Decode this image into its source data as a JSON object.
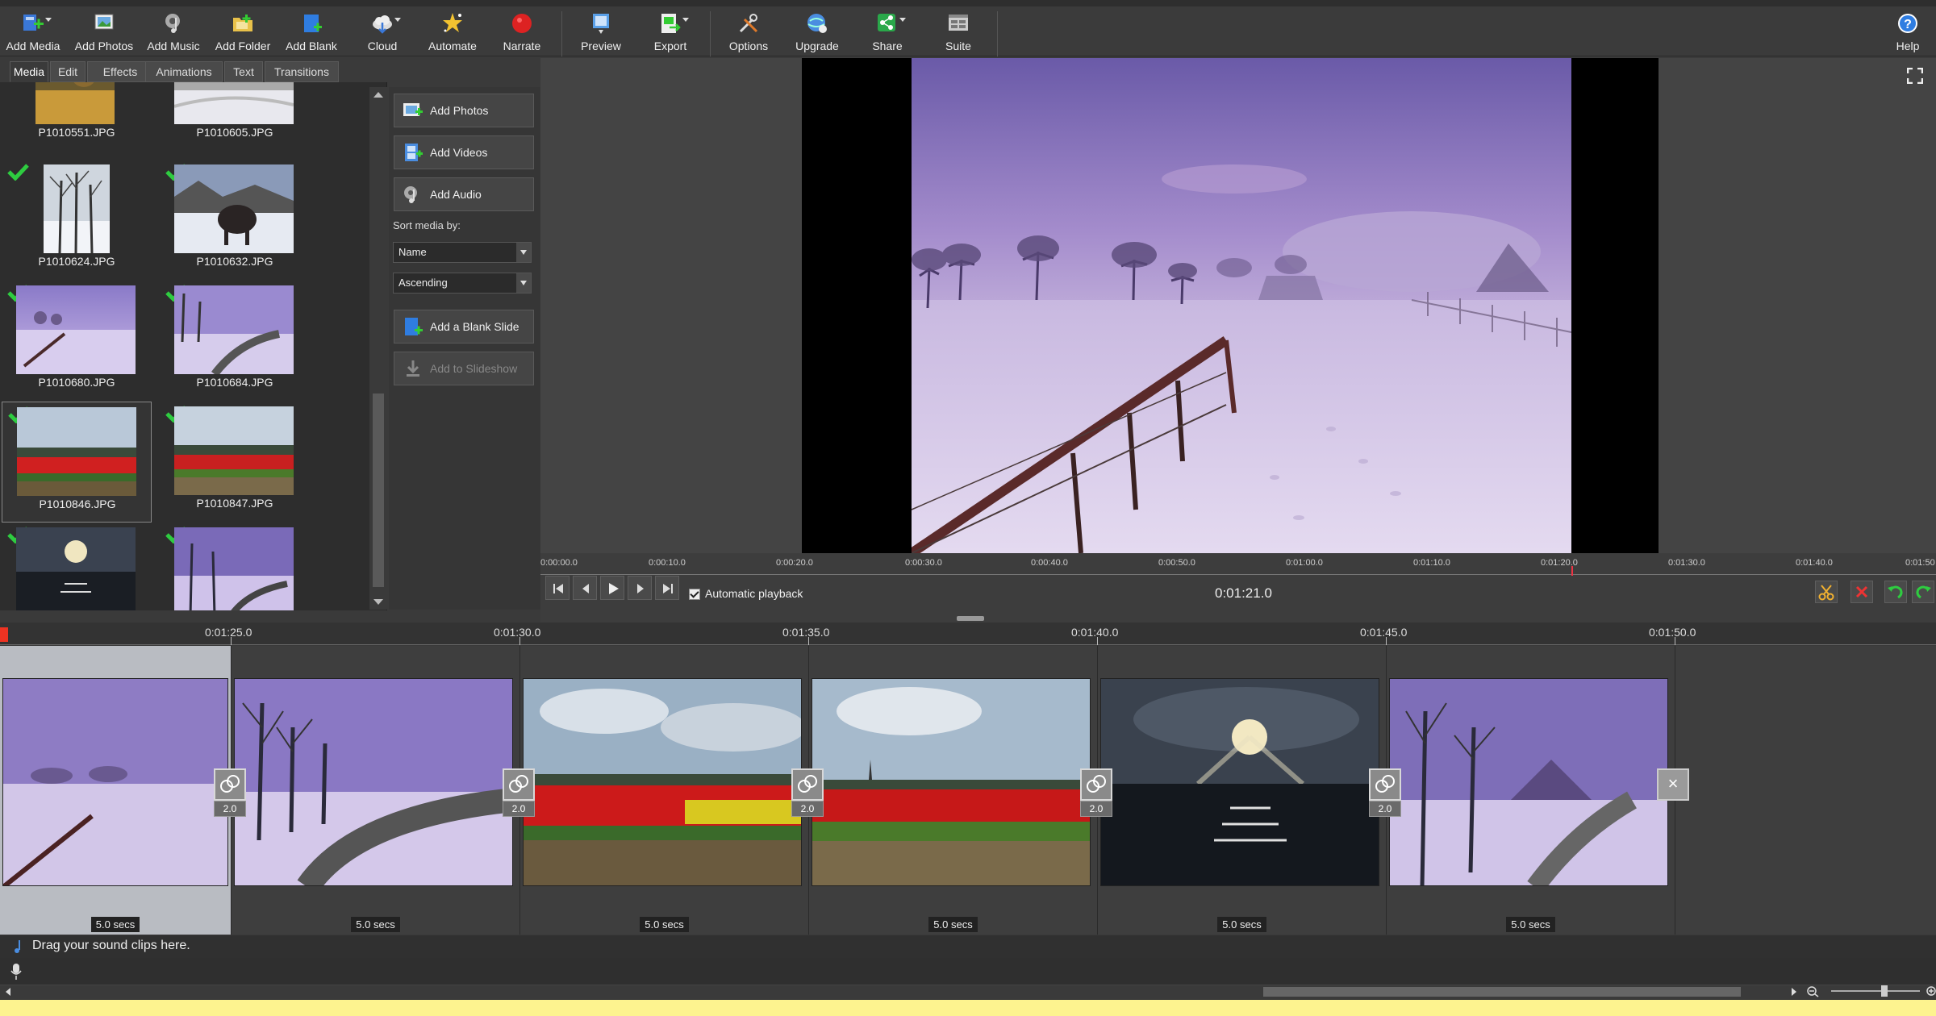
{
  "toolbar": {
    "items": [
      {
        "label": "Add Media",
        "icon": "add-media-icon"
      },
      {
        "label": "Add Photos",
        "icon": "add-photos-icon"
      },
      {
        "label": "Add Music",
        "icon": "add-music-icon"
      },
      {
        "label": "Add Folder",
        "icon": "add-folder-icon"
      },
      {
        "label": "Add Blank",
        "icon": "add-blank-icon"
      },
      {
        "label": "Cloud",
        "icon": "cloud-icon"
      },
      {
        "label": "Automate",
        "icon": "automate-icon"
      },
      {
        "label": "Narrate",
        "icon": "narrate-icon"
      },
      {
        "label": "Preview",
        "icon": "preview-icon"
      },
      {
        "label": "Export",
        "icon": "export-icon"
      },
      {
        "label": "Options",
        "icon": "options-icon"
      },
      {
        "label": "Upgrade",
        "icon": "upgrade-icon"
      },
      {
        "label": "Share",
        "icon": "share-icon"
      },
      {
        "label": "Suite",
        "icon": "suite-icon"
      },
      {
        "label": "Help",
        "icon": "help-icon"
      }
    ]
  },
  "tabs": [
    "Media",
    "Edit",
    "Effects",
    "Animations",
    "Text",
    "Transitions"
  ],
  "media": {
    "files": [
      "P1010551.JPG",
      "P1010605.JPG",
      "P1010624.JPG",
      "P1010632.JPG",
      "P1010680.JPG",
      "P1010684.JPG",
      "P1010846.JPG",
      "P1010847.JPG"
    ]
  },
  "side": {
    "add_photos": "Add Photos",
    "add_videos": "Add Videos",
    "add_audio": "Add Audio",
    "sort_label": "Sort media by:",
    "sort_value": "Name",
    "order_value": "Ascending",
    "add_blank": "Add a Blank Slide",
    "add_to_slideshow": "Add to Slideshow"
  },
  "preview": {
    "ruler_ticks": [
      "0:00:00.0",
      "0:00:10.0",
      "0:00:20.0",
      "0:00:30.0",
      "0:00:40.0",
      "0:00:50.0",
      "0:01:00.0",
      "0:01:10.0",
      "0:01:20.0",
      "0:01:30.0",
      "0:01:40.0",
      "0:01:50"
    ],
    "autoplay_label": "Automatic playback",
    "current_time": "0:01:21.0"
  },
  "timeline": {
    "ticks": [
      "0:01:25.0",
      "0:01:30.0",
      "0:01:35.0",
      "0:01:40.0",
      "0:01:45.0",
      "0:01:50.0"
    ],
    "slides": [
      {
        "duration": "5.0 secs",
        "transition": "2.0"
      },
      {
        "duration": "5.0 secs",
        "transition": "2.0"
      },
      {
        "duration": "5.0 secs",
        "transition": "2.0"
      },
      {
        "duration": "5.0 secs",
        "transition": "2.0"
      },
      {
        "duration": "5.0 secs",
        "transition": "2.0"
      },
      {
        "duration": "5.0 secs",
        "transition": ""
      }
    ],
    "end_marker": "×",
    "sound_hint": "Drag your sound clips here."
  },
  "colors": {
    "accent_green": "#2ecc40",
    "record_red": "#d22",
    "status_bg": "#fdf38f"
  }
}
